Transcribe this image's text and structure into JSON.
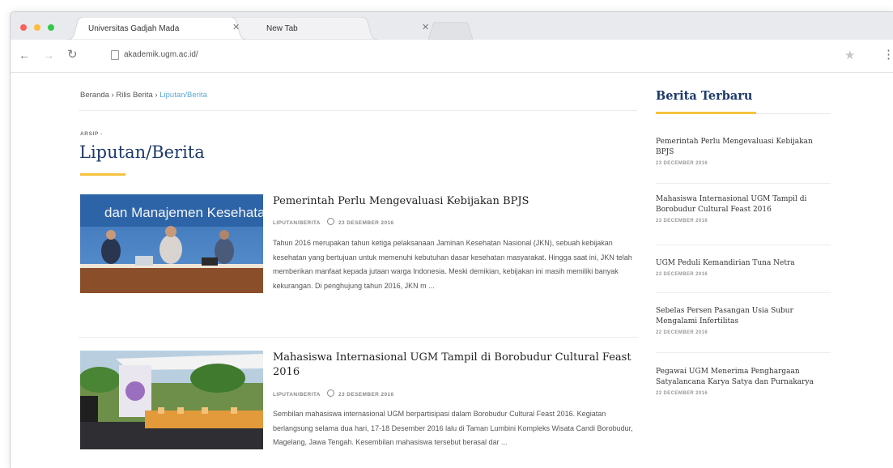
{
  "browser": {
    "tabs": [
      {
        "title": "Universitas Gadjah Mada"
      },
      {
        "title": "New Tab"
      }
    ],
    "url": "akademik.ugm.ac.id/"
  },
  "breadcrumb": {
    "home": "Beranda",
    "section": "Rilis Berita",
    "current": "Liputan/Berita",
    "separator": "›"
  },
  "page": {
    "kicker": "ARSIP -",
    "title": "Liputan/Berita"
  },
  "articles": [
    {
      "title": "Pemerintah Perlu Mengevaluasi Kebijakan BPJS",
      "category": "LIPUTAN/BERITA",
      "date": "23 DESEMBER 2016",
      "excerpt": "Tahun 2016 merupakan tahun ketiga pelaksanaan Jaminan Kesehatan Nasional (JKN), sebuah kebijakan kesehatan yang bertujuan untuk memenuhi kebutuhan dasar kesehatan masyarakat. Hingga saat ini, JKN telah memberikan manfaat kepada jutaan warga Indonesia. Meski demikian, kebijakan ini masih memiliki banyak kekurangan. Di penghujung tahun 2016, JKN m ...",
      "image_banner_text": "dan Manajemen Kesehata"
    },
    {
      "title": "Mahasiswa Internasional UGM Tampil di Borobudur Cultural Feast 2016",
      "category": "LIPUTAN/BERITA",
      "date": "23 DESEMBER 2016",
      "excerpt": "Sembilan mahasiswa internasional UGM berpartisipasi dalam Borobudur Cultural Feast 2016. Kegiatan berlangsung selama dua hari, 17-18 Desember 2016 lalu di Taman Lumbini Kompleks Wisata Candi Borobudur, Magelang, Jawa Tengah. Kesembilan mahasiswa tersebut berasal dar ..."
    }
  ],
  "sidebar": {
    "heading": "Berita Terbaru",
    "items": [
      {
        "title": "Pemerintah Perlu Mengevaluasi Kebijakan BPJS",
        "date": "23 DECEMBER 2016"
      },
      {
        "title": "Mahasiswa Internasional UGM Tampil di Borobudur Cultural Feast 2016",
        "date": "23 DECEMBER 2016"
      },
      {
        "title": "UGM Peduli Kemandirian Tuna Netra",
        "date": "23 DECEMBER 2016"
      },
      {
        "title": "Sebelas Persen Pasangan Usia Subur Mengalami Infertilitas",
        "date": "22 DECEMBER 2016"
      },
      {
        "title": "Pegawai UGM Menerima Penghargaan Satyalancana Karya Satya dan Purnakarya",
        "date": "22 DECEMBER 2016"
      }
    ]
  },
  "colors": {
    "title_blue": "#1d3a6b",
    "accent_yellow": "#f6c33f",
    "link_blue": "#5aa8d2",
    "traffic_red": "#fc605c",
    "traffic_yellow": "#fdbc40",
    "traffic_green": "#34c84a"
  },
  "icons": {
    "back": "back-arrow-icon",
    "forward": "forward-arrow-icon",
    "reload": "reload-icon",
    "bookmark": "star-icon",
    "menu": "kebab-menu-icon",
    "clock": "clock-icon"
  }
}
